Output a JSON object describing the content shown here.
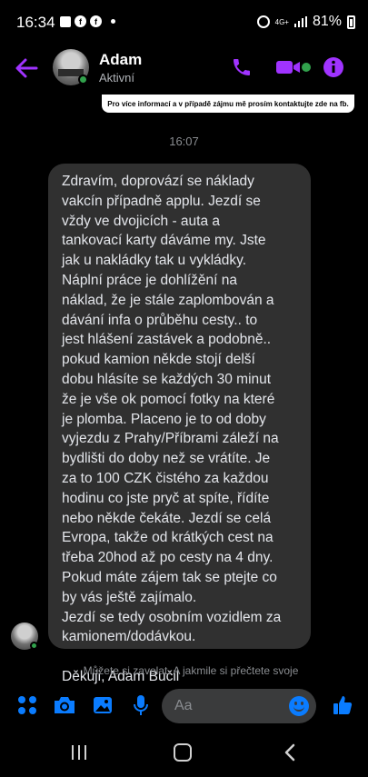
{
  "status_bar": {
    "time": "16:34",
    "left_icons": [
      "gallery-icon",
      "facebook-icon",
      "facebook-icon"
    ],
    "network": "4G+",
    "battery": "81%"
  },
  "header": {
    "contact_name": "Adam",
    "contact_status": "Aktivní",
    "accent_color": "#a033ff"
  },
  "banner": {
    "text": "Pro více informací a v případě zájmu mě prosím kontaktujte zde na fb."
  },
  "conversation": {
    "timestamp": "16:07",
    "message_lines": [
      "Zdravím, doprovází se náklady",
      "vakcín případně applu. Jezdí se",
      "vždy ve dvojicích - auta a",
      "tankovací karty dáváme my. Jste",
      "jak u nakládky tak u vykládky.",
      "Náplní práce je dohlížění na",
      "náklad, že je stále zaplombován a",
      "dávání infa o průběhu cesty.. to",
      "jest hlášení zastávek a podobně..",
      "pokud kamion někde stojí delší",
      "dobu hlásíte se každých 30 minut",
      "že je vše ok pomocí fotky na které",
      "je plomba. Placeno je to od doby",
      "vyjezdu z Prahy/Příbrami záleží na",
      "bydlišti do doby než se vrátíte. Je",
      "za to 100 CZK čistého za každou",
      "hodinu co jste pryč at spíte, řídíte",
      "nebo někde čekáte. Jezdí se celá",
      "Evropa, takže od krátkých cest na",
      "třeba 20hod až po cesty na 4 dny.",
      "Pokud máte zájem tak se ptejte co",
      "by vás ještě zajímalo.",
      "Jezdí se tedy osobním vozidlem za",
      "kamionem/dodávkou.",
      "",
      "Děkuji, Adam Bučil"
    ],
    "hint": "Můžete si zavolat. A jakmile si přečtete svoje"
  },
  "composer": {
    "placeholder": "Aa",
    "icon_color": "#0a7cff"
  }
}
